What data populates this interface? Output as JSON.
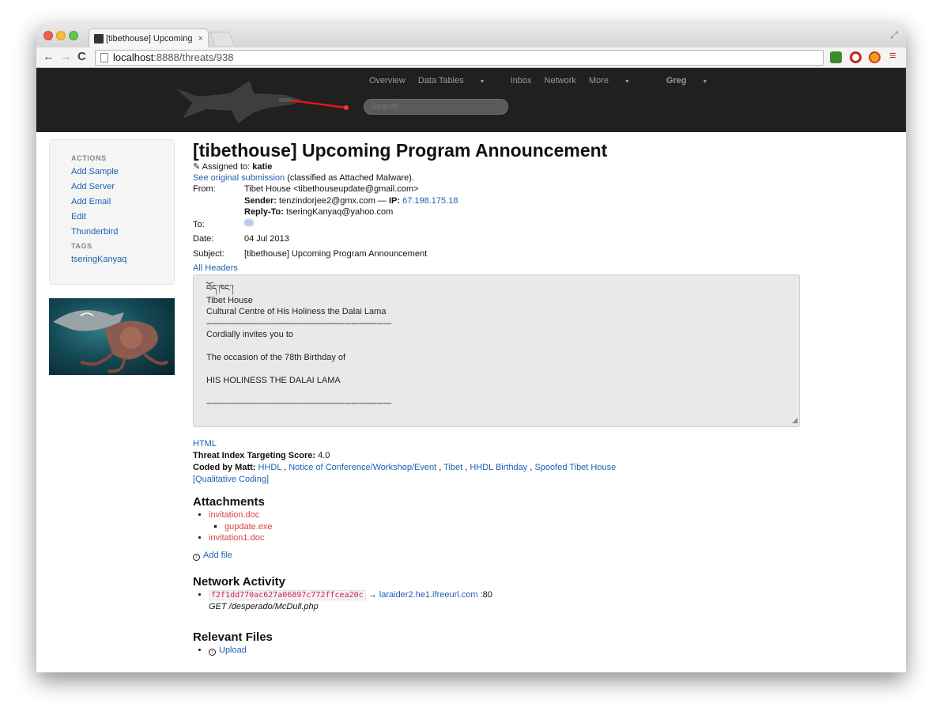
{
  "browser": {
    "tab_title": "[tibethouse] Upcoming Pro",
    "tab_close": "×",
    "url_host": "localhost",
    "url_path": ":8888/threats/938"
  },
  "nav": {
    "items": [
      "Overview",
      "Data Tables",
      "Inbox",
      "Network",
      "More"
    ],
    "user": "Greg",
    "search_placeholder": "Search"
  },
  "sidebar": {
    "actions_header": "ACTIONS",
    "actions": [
      "Add Sample",
      "Add Server",
      "Add Email",
      "Edit",
      "Thunderbird"
    ],
    "tags_header": "TAGS",
    "tags": [
      "tseringKanyaq"
    ]
  },
  "threat": {
    "title": "[tibethouse] Upcoming Program Announcement",
    "assigned_label": "Assigned to:",
    "assigned_to": "katie",
    "submission_link": "See original submission",
    "submission_note": "(classified as Attached Malware).",
    "from_label": "From:",
    "from": "Tibet House <tibethouseupdate@gmail.com>",
    "sender_label": "Sender:",
    "sender": "tenzindorjee2@gmx.com —",
    "ip_label": "IP:",
    "ip": "67.198.175.18",
    "replyto_label": "Reply-To:",
    "replyto": "tseringKanyaq@yahoo.com",
    "to_label": "To:",
    "date_label": "Date:",
    "date": "04 Jul 2013",
    "subject_label": "Subject:",
    "subject": "[tibethouse] Upcoming Program Announcement",
    "all_headers": "All Headers",
    "body_lines": [
      "བོད་ཁང་།",
      "Tibet House",
      "Cultural Centre of His Holiness the Dalai Lama",
      "--------------------------------------------------------------------------",
      "Cordially invites you to",
      "",
      "The occasion of the 78th Birthday of",
      "",
      "HIS HOLINESS THE DALAI LAMA",
      "",
      "--------------------------------------------------------------------------"
    ],
    "html_link": "HTML",
    "score_label": "Threat Index Targeting Score:",
    "score": "4.0",
    "coded_label": "Coded by Matt:",
    "codes": [
      "HHDL",
      "Notice of Conference/Workshop/Event",
      "Tibet",
      "HHDL Birthday",
      "Spoofed Tibet House"
    ],
    "qualitative": "[Qualitative Coding]"
  },
  "attachments": {
    "heading": "Attachments",
    "file1": "invitation.doc",
    "file1_child": "gupdate.exe",
    "file2": "invitation1.doc",
    "add_file": "Add file"
  },
  "network": {
    "heading": "Network Activity",
    "hash": "f2f1dd770ac627a06897c772ffcea20c",
    "arrow": "→",
    "host": "laraider2.he1.ifreeurl.com",
    "port": ":80",
    "request": "GET /desperado/McDull.php"
  },
  "relevant": {
    "heading": "Relevant Files",
    "upload": "Upload"
  }
}
